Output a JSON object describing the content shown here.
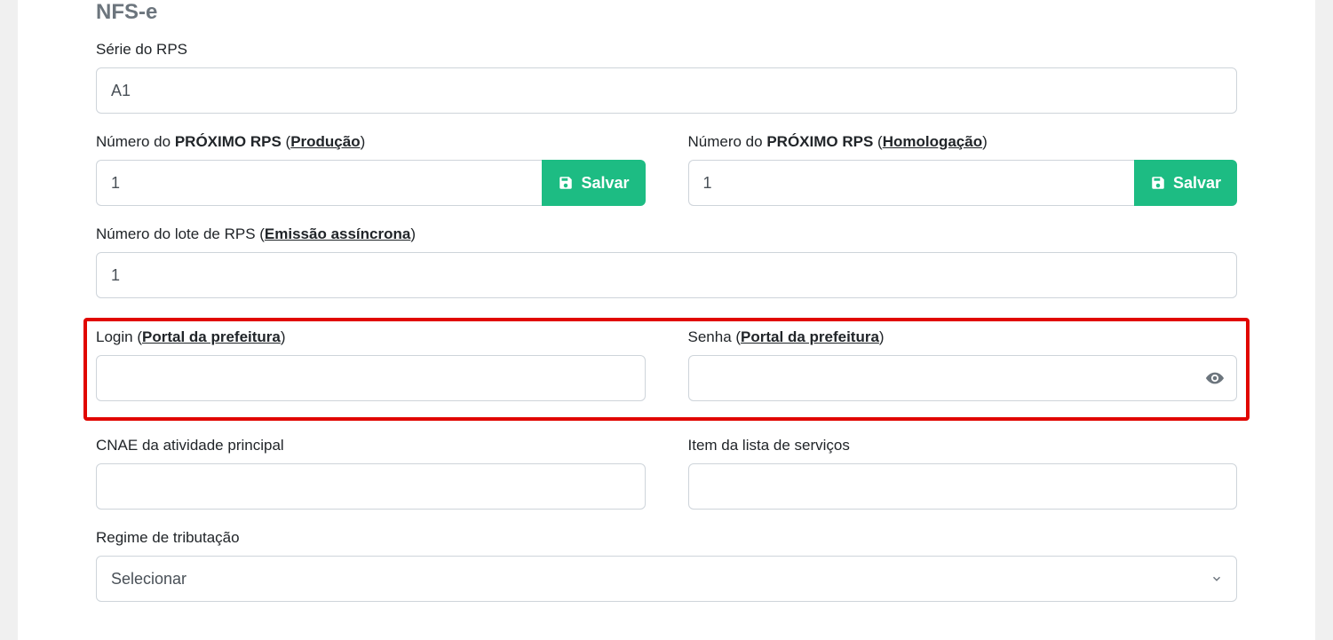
{
  "section": {
    "title": "NFS-e"
  },
  "serie_rps": {
    "label": "Série do RPS",
    "value": "A1"
  },
  "prox_rps_prod": {
    "label_pre": "Número do ",
    "label_bold": "PRÓXIMO RPS",
    "label_paren_open": " (",
    "label_link": "Produção",
    "label_paren_close": ")",
    "value": "1",
    "save": "Salvar"
  },
  "prox_rps_hom": {
    "label_pre": "Número do ",
    "label_bold": "PRÓXIMO RPS",
    "label_paren_open": " (",
    "label_link": "Homologação",
    "label_paren_close": ")",
    "value": "1",
    "save": "Salvar"
  },
  "lote_rps": {
    "label_pre": "Número do lote de RPS (",
    "label_link": "Emissão assíncrona",
    "label_close": ")",
    "value": "1"
  },
  "login": {
    "label_pre": "Login (",
    "label_link": "Portal da prefeitura",
    "label_close": ")",
    "value": ""
  },
  "senha": {
    "label_pre": "Senha (",
    "label_link": "Portal da prefeitura",
    "label_close": ")",
    "value": ""
  },
  "cnae": {
    "label": "CNAE da atividade principal",
    "value": ""
  },
  "item_lista": {
    "label": "Item da lista de serviços",
    "value": ""
  },
  "regime": {
    "label": "Regime de tributação",
    "selected": "Selecionar"
  }
}
